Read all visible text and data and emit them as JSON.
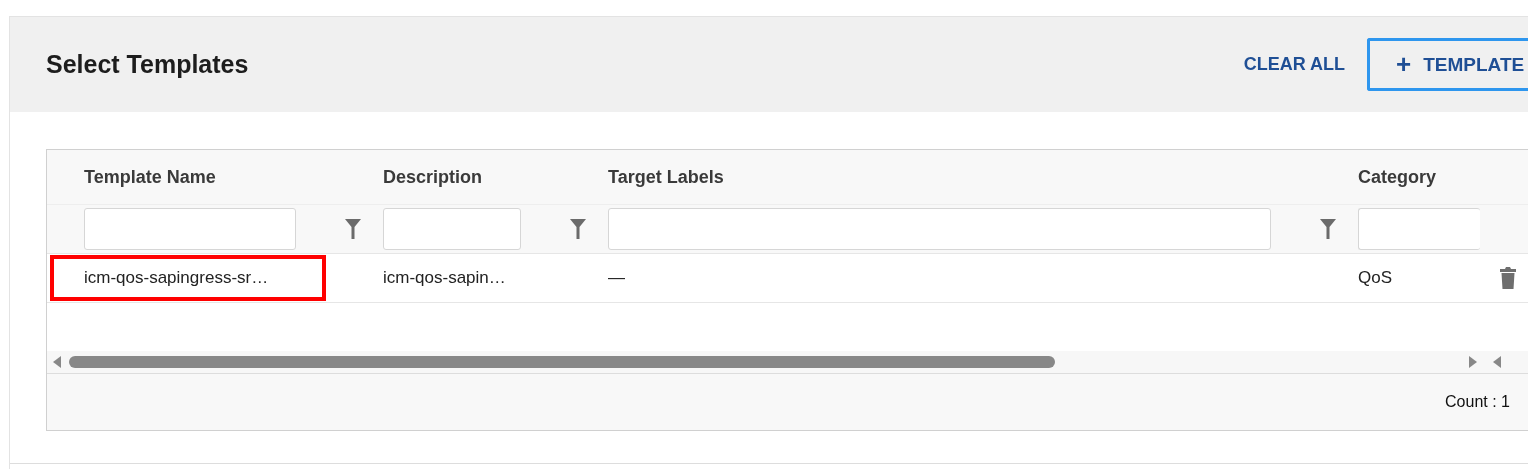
{
  "header": {
    "title": "Select Templates",
    "clear_button": "CLEAR ALL",
    "add_button": {
      "icon": "+",
      "label": "TEMPLATE"
    }
  },
  "table": {
    "columns": [
      {
        "label": "Template Name",
        "filter": true
      },
      {
        "label": "Description",
        "filter": true
      },
      {
        "label": "Target Labels",
        "filter": true
      },
      {
        "label": "Category"
      }
    ],
    "rows": [
      {
        "cells": [
          "icm-qos-sapingress-sr…",
          "icm-qos-sapin…",
          "—",
          "QoS"
        ],
        "highlighted": true
      }
    ],
    "count": "Count : 1"
  }
}
